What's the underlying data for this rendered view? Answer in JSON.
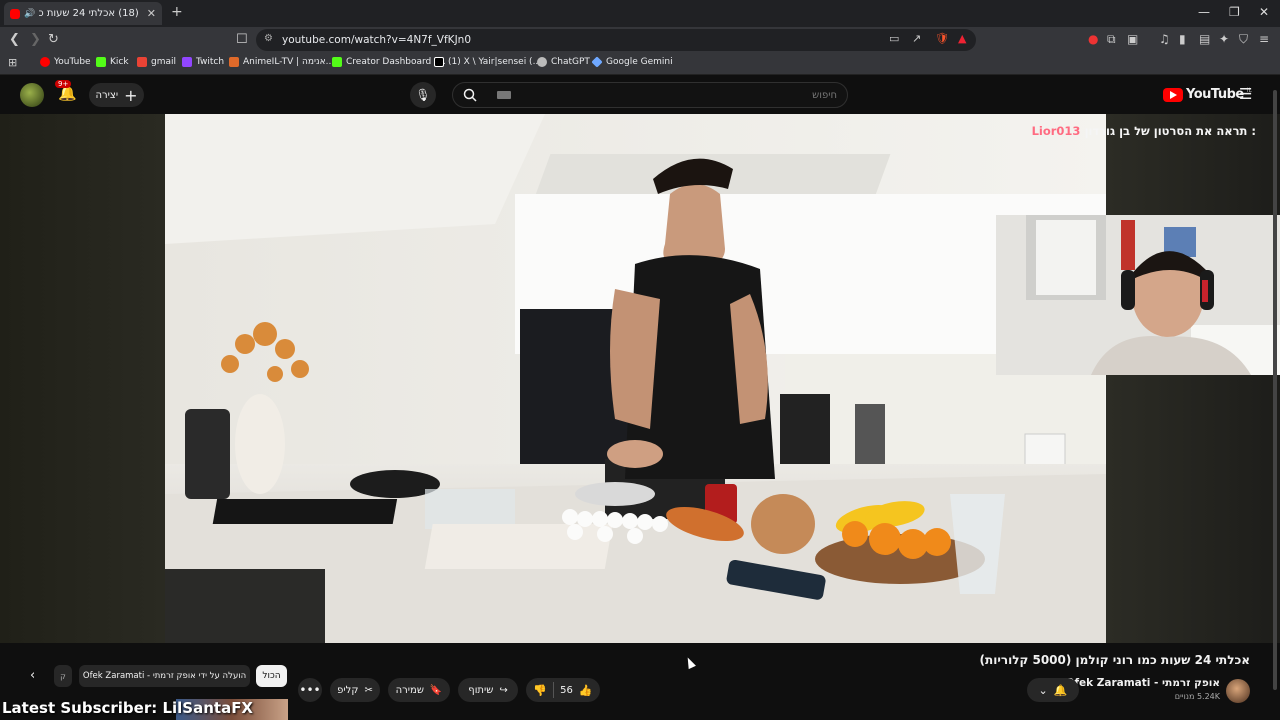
{
  "browser": {
    "tab_title": "(18) אכלתי 24 שעות כמו רוני קולמן (5000 קלוריות) - YouTube",
    "url": "youtube.com/watch?v=4N7f_VfKJn0",
    "bookmarks": [
      {
        "label": "YouTube",
        "icon": "youtube-icon",
        "color": "#ff0000"
      },
      {
        "label": "Kick",
        "icon": "kick-icon",
        "color": "#53fc18"
      },
      {
        "label": "gmail",
        "icon": "gmail-icon",
        "color": "#ea4335"
      },
      {
        "label": "Twitch",
        "icon": "twitch-icon",
        "color": "#9146ff"
      },
      {
        "label": "AnimeIL-TV | אנימה...",
        "icon": "animeil-icon",
        "color": "#e06a2a"
      },
      {
        "label": "Creator Dashboard |...",
        "icon": "kick-icon",
        "color": "#53fc18"
      },
      {
        "label": "(1) X \\ Yair|sensei (...",
        "icon": "x-icon",
        "color": "#ffffff"
      },
      {
        "label": "ChatGPT",
        "icon": "chatgpt-icon",
        "color": "#cccccc"
      },
      {
        "label": "Google Gemini",
        "icon": "gemini-icon",
        "color": "#6fa8ff"
      }
    ]
  },
  "header": {
    "create_label": "יצירה",
    "notif_count": "9+",
    "search_placeholder": "חיפוש",
    "logo_text": "YouTube",
    "logo_suffix": "IL"
  },
  "overlay": {
    "user": "Lior013",
    "message": ": תראה את הסרטון של בן גורדון"
  },
  "video": {
    "title": "אכלתי 24 שעות כמו רוני קולמן (5000 קלוריות)",
    "channel_name": "אופק זרמתי - Ofek Zaramati",
    "subscribers": "5.24K מנויים",
    "likes": "56",
    "share_label": "שיתוף",
    "save_label": "שמירה",
    "clip_label": "קליפ"
  },
  "chips": {
    "all_label": "הכול",
    "uploaded_by_label": "הועלה על ידי אופק זרמתי - Ofek Zaramati",
    "prev_label": "ק"
  },
  "stream_overlay": {
    "latest_subscriber": "Latest Subscriber: LilSantaFX"
  },
  "colors": {
    "accent": "#ff0000",
    "highlight_user": "#ff6b81"
  }
}
